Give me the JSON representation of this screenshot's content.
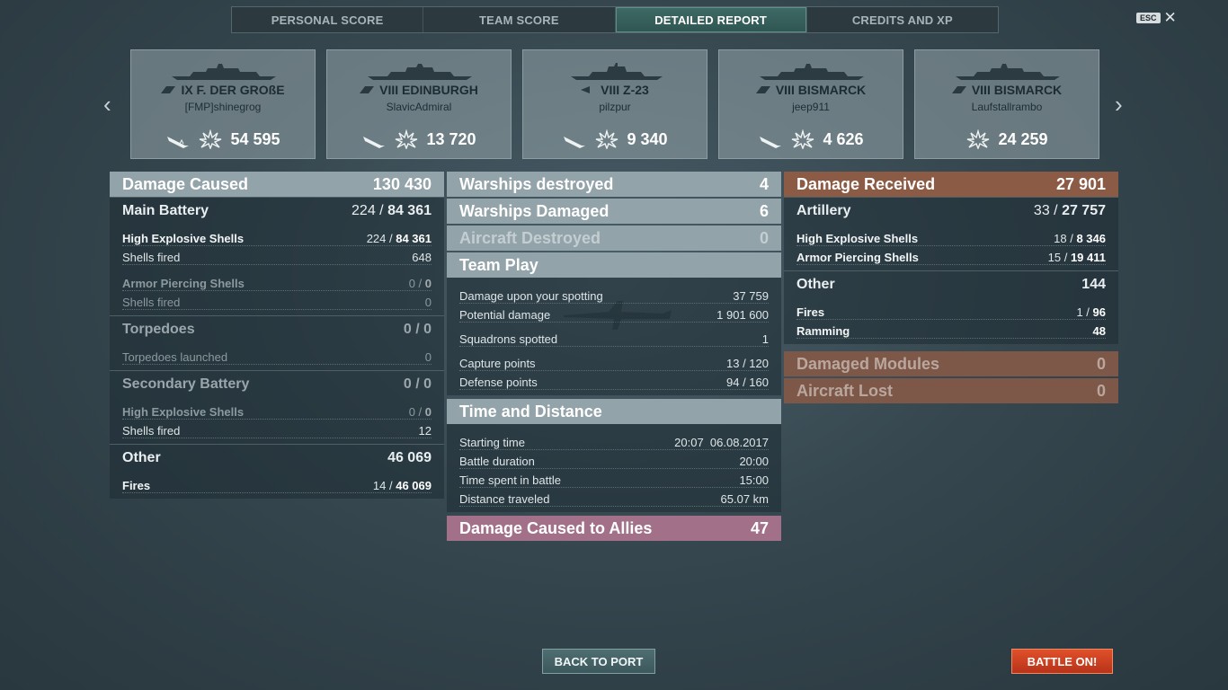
{
  "tabs": [
    {
      "label": "PERSONAL SCORE"
    },
    {
      "label": "TEAM SCORE"
    },
    {
      "label": "DETAILED REPORT",
      "active": true
    },
    {
      "label": "CREDITS AND XP"
    }
  ],
  "esc": {
    "key": "ESC",
    "close": "✕"
  },
  "nav": {
    "prev": "‹",
    "next": "›"
  },
  "ships": [
    {
      "name": "IX F. DER GROßE",
      "player": "[FMP]shinegrog",
      "damage": "54 595"
    },
    {
      "name": "VIII EDINBURGH",
      "player": "SlavicAdmiral",
      "damage": "13 720"
    },
    {
      "name": "VIII Z-23",
      "player": "pilzpur",
      "damage": "9 340"
    },
    {
      "name": "VIII BISMARCK",
      "player": "jeep911",
      "damage": "4 626"
    },
    {
      "name": "VIII BISMARCK",
      "player": "Laufstallrambo",
      "damage": "24 259"
    }
  ],
  "damage_caused": {
    "title": "Damage Caused",
    "value": "130 430",
    "main_battery": {
      "title": "Main Battery",
      "hits": "224",
      "damage": "84 361"
    },
    "mb_he_label": "High Explosive Shells",
    "mb_he_hits": "224",
    "mb_he_dmg": "84 361",
    "mb_he_fired_label": "Shells fired",
    "mb_he_fired": "648",
    "mb_ap_label": "Armor Piercing Shells",
    "mb_ap_hits": "0",
    "mb_ap_dmg": "0",
    "mb_ap_fired_label": "Shells fired",
    "mb_ap_fired": "0",
    "torpedoes": {
      "title": "Torpedoes",
      "value": "0 / 0"
    },
    "torp_launched_label": "Torpedoes launched",
    "torp_launched": "0",
    "secondary": {
      "title": "Secondary Battery",
      "value": "0 / 0"
    },
    "sec_he_label": "High Explosive Shells",
    "sec_he_hits": "0",
    "sec_he_dmg": "0",
    "sec_fired_label": "Shells fired",
    "sec_fired": "12",
    "other": {
      "title": "Other",
      "value": "46 069"
    },
    "fires_label": "Fires",
    "fires_hits": "14",
    "fires_dmg": "46 069"
  },
  "center": {
    "warships_destroyed": {
      "title": "Warships destroyed",
      "value": "4"
    },
    "warships_damaged": {
      "title": "Warships Damaged",
      "value": "6"
    },
    "aircraft_destroyed": {
      "title": "Aircraft Destroyed",
      "value": "0"
    },
    "team_play": {
      "title": "Team Play"
    },
    "spotting_label": "Damage upon your spotting",
    "spotting": "37 759",
    "potential_label": "Potential damage",
    "potential": "1 901 600",
    "squadrons_label": "Squadrons spotted",
    "squadrons": "1",
    "capture_label": "Capture points",
    "capture": "13 / 120",
    "defense_label": "Defense points",
    "defense": "94 / 160",
    "time_distance": {
      "title": "Time and Distance"
    },
    "start_label": "Starting time",
    "start_time": "20:07",
    "start_date": "06.08.2017",
    "duration_label": "Battle duration",
    "duration": "20:00",
    "time_spent_label": "Time spent in battle",
    "time_spent": "15:00",
    "distance_label": "Distance traveled",
    "distance": "65.07 km",
    "allies": {
      "title": "Damage Caused to Allies",
      "value": "47"
    }
  },
  "damage_received": {
    "title": "Damage Received",
    "value": "27 901",
    "artillery": {
      "title": "Artillery",
      "hits": "33",
      "damage": "27 757"
    },
    "he_label": "High Explosive Shells",
    "he_hits": "18",
    "he_dmg": "8 346",
    "ap_label": "Armor Piercing Shells",
    "ap_hits": "15",
    "ap_dmg": "19 411",
    "other": {
      "title": "Other",
      "value": "144"
    },
    "fires_label": "Fires",
    "fires_hits": "1",
    "fires_dmg": "96",
    "ramming_label": "Ramming",
    "ramming": "48",
    "modules": {
      "title": "Damaged Modules",
      "value": "0"
    },
    "aircraft_lost": {
      "title": "Aircraft Lost",
      "value": "0"
    }
  },
  "buttons": {
    "back": "BACK TO PORT",
    "battle": "BATTLE ON!"
  },
  "colors": {
    "accent_tab": "#3f6a66",
    "damage_received": "#8c5b45",
    "allies": "#a27089",
    "battle_button": "#d0421f"
  }
}
